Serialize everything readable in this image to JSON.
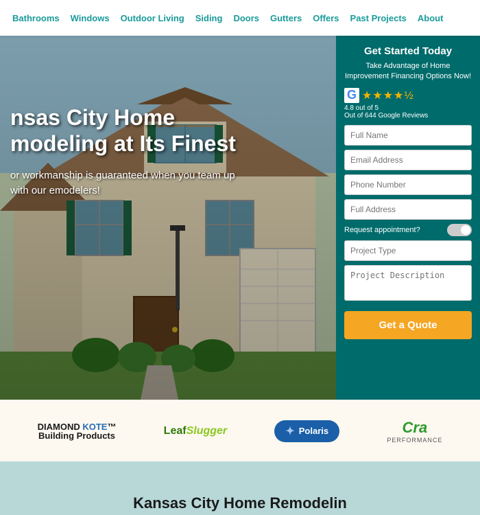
{
  "nav": {
    "items": [
      {
        "label": "Bathrooms",
        "href": "#"
      },
      {
        "label": "Windows",
        "href": "#"
      },
      {
        "label": "Outdoor Living",
        "href": "#"
      },
      {
        "label": "Siding",
        "href": "#"
      },
      {
        "label": "Doors",
        "href": "#"
      },
      {
        "label": "Gutters",
        "href": "#"
      },
      {
        "label": "Offers",
        "href": "#"
      },
      {
        "label": "Past Projects",
        "href": "#"
      },
      {
        "label": "About",
        "href": "#"
      }
    ]
  },
  "hero": {
    "headline_line1": "nsas City Home",
    "headline_line2": "modeling at Its Finest",
    "subtext": "or workmanship is guaranteed when you team up with our emodelers!"
  },
  "form": {
    "title": "Get Started Today",
    "subtitle": "Take Advantage of Home Improvement Financing Options Now!",
    "google_rating": "4.8 out of 5",
    "google_reviews": "Out of 644 Google Reviews",
    "fields": {
      "full_name_placeholder": "Full Name",
      "email_placeholder": "Email Address",
      "phone_placeholder": "Phone Number",
      "address_placeholder": "Full Address",
      "appointment_label": "Request appointment?",
      "project_type_placeholder": "Project Type",
      "project_desc_placeholder": "Project Description"
    },
    "submit_label": "Get a Quote"
  },
  "brands": [
    {
      "name": "diamond-kote",
      "line1": "DIAMOND KOTE",
      "line2": "Building Products"
    },
    {
      "name": "leaf-slugger",
      "line1": "Leaf Slugger"
    },
    {
      "name": "polaris",
      "line1": "Polaris"
    },
    {
      "name": "cra",
      "line1": "Cra"
    }
  ],
  "bottom": {
    "title": "Kansas City Home Remodelin"
  }
}
